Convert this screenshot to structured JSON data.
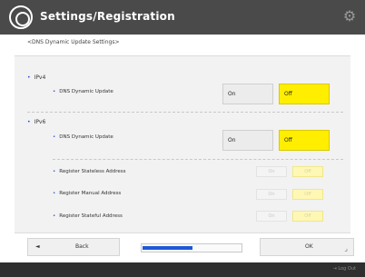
{
  "header": {
    "title": "Settings/Registration",
    "logo_icon": "settings-registration-icon",
    "gear_icon": "gear-icon"
  },
  "subtitle": "<DNS Dynamic Update Settings>",
  "ipv4": {
    "label": "IPv4",
    "rows": [
      {
        "label": "DNS Dynamic Update",
        "on": "On",
        "off": "Off",
        "selected": "Off"
      }
    ]
  },
  "ipv6": {
    "label": "IPv6",
    "rows": [
      {
        "label": "DNS Dynamic Update",
        "on": "On",
        "off": "Off",
        "selected": "Off"
      },
      {
        "label": "Register Stateless Address",
        "on": "On",
        "off": "Off",
        "selected": "Off",
        "disabled": true
      },
      {
        "label": "Register Manual Address",
        "on": "On",
        "off": "Off",
        "selected": "Off",
        "disabled": true
      },
      {
        "label": "Register Stateful Address",
        "on": "On",
        "off": "Off",
        "selected": "Off",
        "disabled": true
      }
    ]
  },
  "footer": {
    "back_label": "Back",
    "back_icon": "left-arrow-icon",
    "ok_label": "OK",
    "ok_corner_icon": "resize-corner-icon",
    "progress": 0.5
  },
  "status_bar": {
    "login_text": "Log Out",
    "login_icon": "logout-icon"
  },
  "colors": {
    "header_bg": "#4a4a4a",
    "selected": "#ffee00",
    "accent_blue": "#1e58d8"
  }
}
